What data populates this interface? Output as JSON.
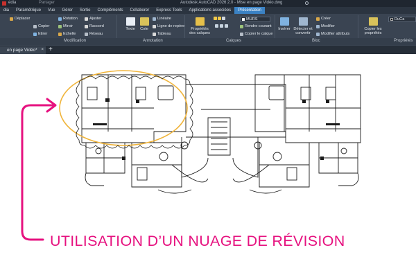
{
  "titlebar": {
    "left": "édia",
    "share": "Partager",
    "center": "Autodesk AutoCAD 2026  2.0 - Mise en page Vidéo.dwg"
  },
  "ribbon_tabs": [
    "dia",
    "Paramétrique",
    "Vue",
    "Gérer",
    "Sortie",
    "Compléments",
    "Collaborer",
    "Express Tools",
    "Applications associées",
    "Présentation"
  ],
  "active_tab": "Présentation",
  "ribbon": {
    "modification": {
      "deplacer": "Déplacer",
      "rotation": "Rotation",
      "ajuster": "Ajuster",
      "copier": "Copier",
      "miroir": "Miroir",
      "raccord": "Raccord",
      "etirer": "Etirer",
      "echelle": "Echelle",
      "reseau": "Réseau"
    },
    "annotation": {
      "texte": "Texte",
      "cote": "Cote",
      "lineaire": "Linéaire",
      "ligne_repere": "Ligne de repère",
      "tableau": "Tableau"
    },
    "calques": {
      "proprietes": "Propriétés des calques",
      "layer_name": "MURS",
      "rendre_courant": "Rendre courant",
      "copier_calque": "Copier le calque"
    },
    "bloc": {
      "inserer": "Insérer",
      "detecter": "Détecter et convertir",
      "creer": "Créer",
      "modifier": "Modifier",
      "modifier_attributs": "Modifier attributs"
    },
    "proprietes": {
      "copier_proprietes": "Copier les propriétés",
      "color": "DuCa"
    },
    "panel_labels": {
      "modification": "Modification",
      "annotation": "Annotation",
      "calques": "Calques",
      "bloc": "Bloc",
      "proprietes": "Propriétés"
    }
  },
  "file_tab": {
    "label": "en page Vidéo*",
    "close": "×",
    "new": "+"
  },
  "caption": "UTILISATION D’UN NUAGE DE RÉVISION",
  "colors": {
    "accent_pink": "#e6117f",
    "highlight_orange": "#f0b43a",
    "ribbon_bg": "#3a4452",
    "tab_active": "#3b82c4"
  }
}
